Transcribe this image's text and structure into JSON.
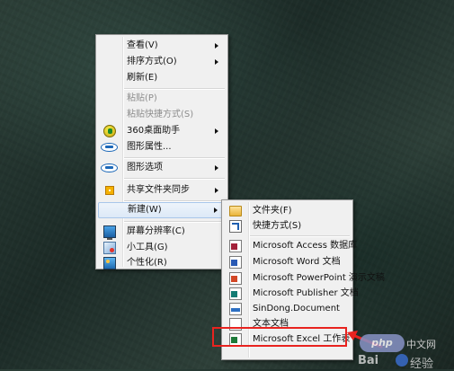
{
  "context_menu": {
    "items": [
      {
        "label": "查看(V)",
        "submenu": true
      },
      {
        "label": "排序方式(O)",
        "submenu": true
      },
      {
        "label": "刷新(E)"
      },
      {
        "label": "粘贴(P)",
        "disabled": true
      },
      {
        "label": "粘贴快捷方式(S)",
        "disabled": true
      },
      {
        "label": "360桌面助手",
        "icon": "360-icon",
        "submenu": true
      },
      {
        "label": "图形属性...",
        "icon": "intel-graphics-icon"
      },
      {
        "label": "图形选项",
        "icon": "intel-graphics-icon",
        "submenu": true
      },
      {
        "label": "共享文件夹同步",
        "icon": "shared-folder-sync-icon",
        "submenu": true
      },
      {
        "label": "新建(W)",
        "submenu": true,
        "highlighted": true
      },
      {
        "label": "屏幕分辨率(C)",
        "icon": "monitor-icon"
      },
      {
        "label": "小工具(G)",
        "icon": "gadgets-icon"
      },
      {
        "label": "个性化(R)",
        "icon": "personalize-icon"
      }
    ]
  },
  "new_submenu": {
    "items": [
      {
        "label": "文件夹(F)",
        "icon": "folder-icon"
      },
      {
        "label": "快捷方式(S)",
        "icon": "shortcut-icon"
      },
      {
        "label": "Microsoft Access 数据库",
        "icon": "access-icon"
      },
      {
        "label": "Microsoft Word 文档",
        "icon": "word-icon"
      },
      {
        "label": "Microsoft PowerPoint 演示文稿",
        "icon": "powerpoint-icon"
      },
      {
        "label": "Microsoft Publisher 文档",
        "icon": "publisher-icon"
      },
      {
        "label": "SinDong.Document",
        "icon": "sindong-icon"
      },
      {
        "label": "文本文档",
        "icon": "text-document-icon"
      },
      {
        "label": "Microsoft Excel 工作表",
        "icon": "excel-icon",
        "annotated": true
      }
    ]
  },
  "watermarks": {
    "php": "php",
    "php_cn": "中文网",
    "baidu": "Bai",
    "jingyan": "经验"
  },
  "colors": {
    "menu_bg": "#f0f0f0",
    "highlight_border": "#a8c6ea",
    "annotation_red": "#e8231f"
  }
}
